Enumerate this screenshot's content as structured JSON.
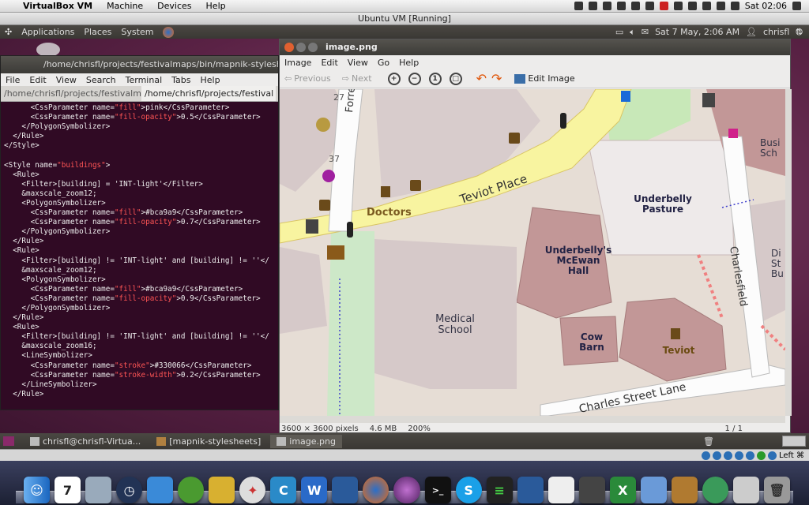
{
  "mac_menubar": {
    "apple": "",
    "app": "VirtualBox VM",
    "items": [
      "Machine",
      "Devices",
      "Help"
    ],
    "clock": "Sat 02:06"
  },
  "vbox_window": {
    "title": "Ubuntu VM [Running]"
  },
  "ubuntu_panel": {
    "menus": [
      "Applications",
      "Places",
      "System"
    ],
    "datetime": "Sat 7 May,  2:06 AM",
    "user": "chrisfl"
  },
  "terminal": {
    "title": "/home/chrisfl/projects/festivalmaps/bin/mapnik-stylesheets",
    "menu": [
      "File",
      "Edit",
      "View",
      "Search",
      "Terminal",
      "Tabs",
      "Help"
    ],
    "tabs": [
      "/home/chrisfl/projects/festivalma...",
      "/home/chrisfl/projects/festival"
    ],
    "lines": [
      "      <CssParameter name=\"fill\">pink</CssParameter>",
      "      <CssParameter name=\"fill-opacity\">0.5</CssParameter>",
      "    </PolygonSymbolizer>",
      "  </Rule>",
      "</Style>",
      "",
      "<Style name=\"buildings\">",
      "  <Rule>",
      "    <Filter>[building] = 'INT-light'</Filter>",
      "    &maxscale_zoom12;",
      "    <PolygonSymbolizer>",
      "      <CssParameter name=\"fill\">#bca9a9</CssParameter>",
      "      <CssParameter name=\"fill-opacity\">0.7</CssParameter>",
      "    </PolygonSymbolizer>",
      "  </Rule>",
      "  <Rule>",
      "    <Filter>[building] != 'INT-light' and [building] != ''</",
      "    &maxscale_zoom12;",
      "    <PolygonSymbolizer>",
      "      <CssParameter name=\"fill\">#bca9a9</CssParameter>",
      "      <CssParameter name=\"fill-opacity\">0.9</CssParameter>",
      "    </PolygonSymbolizer>",
      "  </Rule>",
      "  <Rule>",
      "    <Filter>[building] != 'INT-light' and [building] != ''</",
      "    &maxscale_zoom16;",
      "    <LineSymbolizer>",
      "      <CssParameter name=\"stroke\">#330066</CssParameter>",
      "      <CssParameter name=\"stroke-width\">0.2</CssParameter>",
      "    </LineSymbolizer>",
      "  </Rule>"
    ]
  },
  "viewer": {
    "title": "image.png",
    "menu": [
      "Image",
      "Edit",
      "View",
      "Go",
      "Help"
    ],
    "prev": "Previous",
    "next": "Next",
    "edit": "Edit Image",
    "status": {
      "dims": "3600 × 3600 pixels",
      "size": "4.6 MB",
      "zoom": "200%",
      "page": "1 / 1"
    }
  },
  "map_labels": {
    "street1": "Teviot Place",
    "street2": "Charles Street Lane",
    "street3": "Charlesfield",
    "street4": "Forre",
    "doctors": "Doctors",
    "underbelly_pasture": "Underbelly\nPasture",
    "underbelly_mcewan": "Underbelly's\nMcEwan\nHall",
    "medical": "Medical\nSchool",
    "cow": "Cow\nBarn",
    "teviot": "Teviot",
    "busi": "Busi\nSch",
    "di": "Di\nSt\nBu",
    "n27": "27",
    "n37": "37"
  },
  "taskbar": {
    "tasks": [
      "chrisfl@chrisfl-Virtua...",
      "[mapnik-stylesheets]",
      "image.png"
    ]
  },
  "vbox_status": {
    "hostkey": "Left ⌘"
  },
  "dock_apps": [
    "Finder",
    "Calendar",
    "Preview",
    "Time Machine",
    "Twitterrific",
    "Adium",
    "Transmit",
    "Safari",
    "Cyberduck",
    "Word",
    "VirtualBox",
    "Firefox",
    "Photo",
    "Terminal",
    "Skype",
    "Activity",
    "VirtualBox",
    "TextEdit",
    "Desktop",
    "Excel",
    "Applications",
    "Archive",
    "Network",
    "Documents",
    "Trash"
  ],
  "colors": {
    "terminal_bg": "#300a24",
    "desktop": "#5a2245",
    "road_yellow": "#f7f3a0",
    "building": "#c49c9c",
    "green": "#c8e8c0"
  }
}
